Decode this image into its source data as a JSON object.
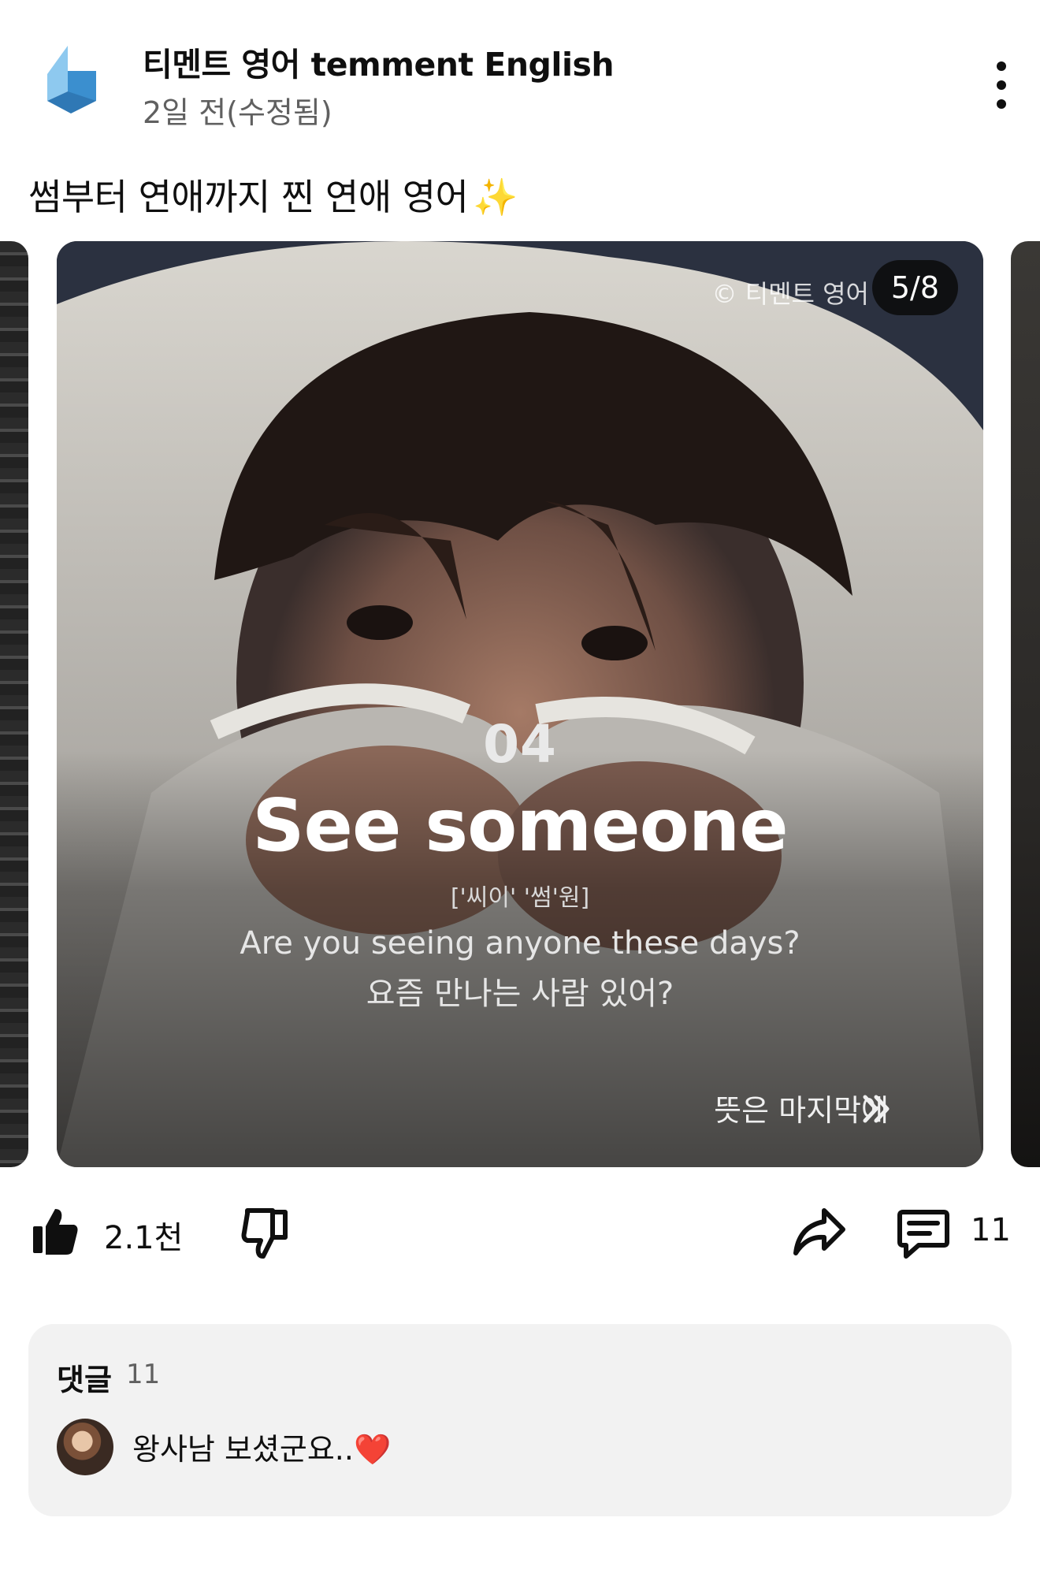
{
  "header": {
    "channel_name": "티멘트 영어 temment English",
    "post_time": "2일 전(수정됨)"
  },
  "post": {
    "text": "썸부터 연애까지 찐 연애 영어",
    "emoji": "✨"
  },
  "carousel": {
    "page_counter": "5/8",
    "watermark": "© 티멘트 영어",
    "card": {
      "number": "04",
      "title": "See someone",
      "pronunciation": "['씨이' '썸'원]",
      "example_en": "Are you seeing anyone these days?",
      "example_ko": "요즘 만나는 사람 있어?",
      "hint": "뜻은 마지막에"
    }
  },
  "actions": {
    "like_count": "2.1천",
    "comment_count": "11"
  },
  "comments": {
    "heading": "댓글",
    "count": "11",
    "top_comment": "왕사남 보셨군요..",
    "top_comment_emoji": "❤️"
  },
  "colors": {
    "brand_blue": "#4a9fd8",
    "text_primary": "#0f0f0f",
    "text_secondary": "#606060",
    "panel_bg": "#f2f2f2"
  }
}
